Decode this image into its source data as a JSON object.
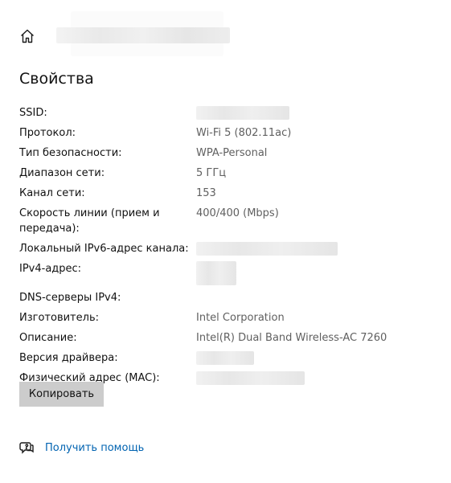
{
  "header": {
    "home_icon": "home-icon",
    "title_redacted": true
  },
  "section": {
    "title": "Свойства"
  },
  "properties": [
    {
      "key": "SSID:",
      "value": "",
      "redacted": true
    },
    {
      "key": "Протокол:",
      "value": "Wi-Fi 5 (802.11ac)"
    },
    {
      "key": "Тип безопасности:",
      "value": "WPA-Personal"
    },
    {
      "key": "Диапазон сети:",
      "value": "5 ГГц"
    },
    {
      "key": "Канал сети:",
      "value": "153"
    },
    {
      "key": "Скорость линии (прием и передача):",
      "value": "400/400 (Mbps)"
    },
    {
      "key": "Локальный IPv6-адрес канала:",
      "value": "",
      "redacted": true
    },
    {
      "key": "IPv4-адрес:",
      "value": "",
      "redacted": true
    },
    {
      "key": "DNS-серверы IPv4:",
      "value": "",
      "redacted": true
    },
    {
      "key": "Изготовитель:",
      "value": "Intel Corporation"
    },
    {
      "key": "Описание:",
      "value": "Intel(R) Dual Band Wireless-AC 7260"
    },
    {
      "key": "Версия драйвера:",
      "value": "",
      "redacted": true
    },
    {
      "key": "Физический адрес (MAC):",
      "value": "",
      "redacted": true
    }
  ],
  "actions": {
    "copy_label": "Копировать"
  },
  "help": {
    "icon": "help-chat-icon",
    "label": "Получить помощь"
  },
  "colors": {
    "link": "#0063b1",
    "value_text": "#606060",
    "button_bg": "#cccccc"
  }
}
